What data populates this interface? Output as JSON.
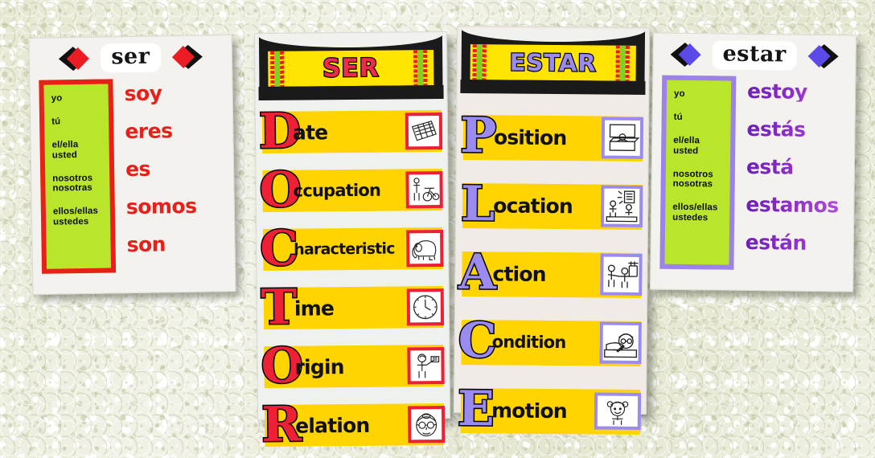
{
  "scene": {
    "title": "Spanish classroom wall posters: ser and estar",
    "background_color": "#eceedc"
  },
  "posters": {
    "ser_conjugation": {
      "title": "ser",
      "accent_color": "#e8201a",
      "pronoun_box_color": "#b9e62a",
      "left_icon": "diamond-left-arrow-icon",
      "right_icon": "diamond-right-arrow-icon",
      "rows": [
        {
          "pronoun": [
            "yo"
          ],
          "form": "soy"
        },
        {
          "pronoun": [
            "tú"
          ],
          "form": "eres"
        },
        {
          "pronoun": [
            "el/ella",
            "usted"
          ],
          "form": "es"
        },
        {
          "pronoun": [
            "nosotros",
            "nosotras"
          ],
          "form": "somos"
        },
        {
          "pronoun": [
            "ellos/ellas",
            "ustedes"
          ],
          "form": "son"
        }
      ]
    },
    "estar_conjugation": {
      "title": "estar",
      "accent_color": "#9c82ea",
      "pronoun_box_color": "#b9e62a",
      "left_icon": "diamond-left-arrow-icon",
      "right_icon": "diamond-right-arrow-icon",
      "rows": [
        {
          "pronoun": [
            "yo"
          ],
          "form": "estoy"
        },
        {
          "pronoun": [
            "tú"
          ],
          "form": "estás"
        },
        {
          "pronoun": [
            "el/ella",
            "usted"
          ],
          "form": "está"
        },
        {
          "pronoun": [
            "nosotros",
            "nosotras"
          ],
          "form": "estamos"
        },
        {
          "pronoun": [
            "ellos/ellas",
            "ustedes"
          ],
          "form": "están"
        }
      ]
    },
    "ser_doctor": {
      "banner": "SER",
      "banner_text_color": "#ee2b4c",
      "banner_bg_color": "#ffe400",
      "letter_color": "#ee2036",
      "bar_color": "#ffd400",
      "frame_color": "#ee2036",
      "rows": [
        {
          "letter": "D",
          "word": "ate",
          "full": "Date",
          "icon": "calendar-icon"
        },
        {
          "letter": "O",
          "word": "ccupation",
          "full": "Occupation",
          "icon": "mechanic-motorcycle-icon"
        },
        {
          "letter": "C",
          "word": "haracteristic",
          "full": "Characteristic",
          "icon": "elephant-icon"
        },
        {
          "letter": "T",
          "word": "ime",
          "full": "Time",
          "icon": "clock-icon"
        },
        {
          "letter": "O",
          "word": "rigin",
          "full": "Origin",
          "icon": "person-holding-flag-icon"
        },
        {
          "letter": "R",
          "word": "elation",
          "full": "Relation",
          "icon": "grandmother-face-icon"
        }
      ]
    },
    "estar_place": {
      "banner": "ESTAR",
      "banner_text_color": "#9b8af0",
      "banner_bg_color": "#ffe400",
      "letter_color": "#9b8af0",
      "bar_color": "#ffd400",
      "frame_color": "#9b8af0",
      "rows": [
        {
          "letter": "P",
          "word": "osition",
          "full": "Position",
          "icon": "person-at-desk-icon"
        },
        {
          "letter": "L",
          "word": "ocation",
          "full": "Location",
          "icon": "people-by-door-icon"
        },
        {
          "letter": "A",
          "word": "ction",
          "full": "Action",
          "icon": "children-playing-icon"
        },
        {
          "letter": "C",
          "word": "ondition",
          "full": "Condition",
          "icon": "sick-person-in-bed-icon"
        },
        {
          "letter": "E",
          "word": "motion",
          "full": "Emotion",
          "icon": "happy-girl-icon"
        }
      ]
    }
  }
}
